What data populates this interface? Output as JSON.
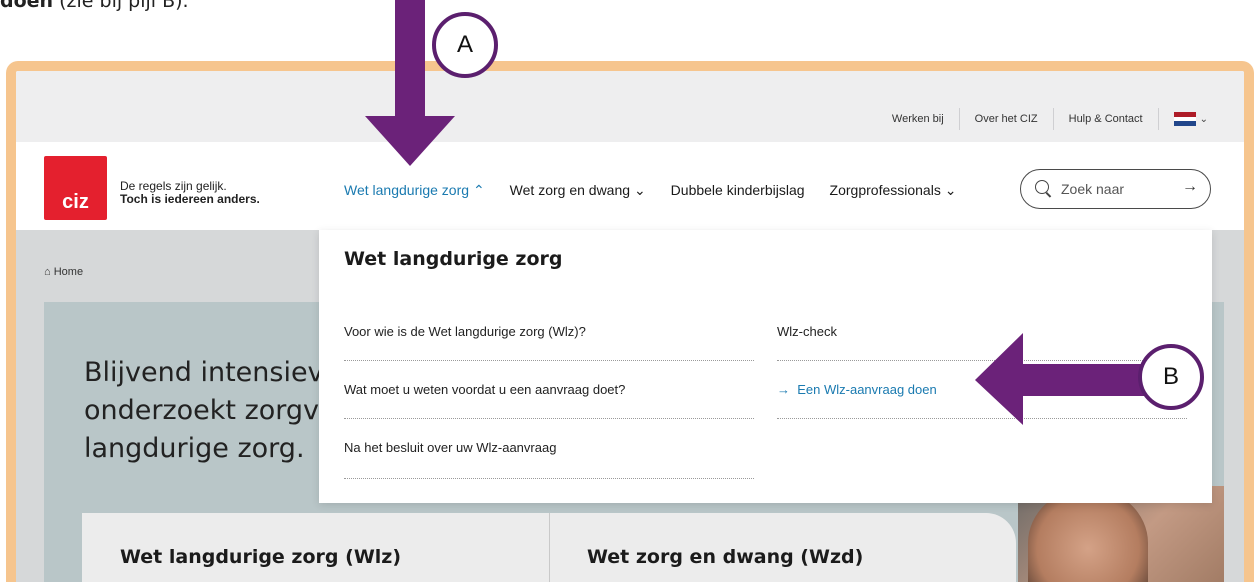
{
  "intro": {
    "bold": "doen",
    "rest": " (zie bij pijl B)."
  },
  "utility_nav": {
    "items": [
      "Werken bij",
      "Over het CIZ",
      "Hulp & Contact"
    ]
  },
  "language": {
    "flag_colors": [
      "#ae1c28",
      "#ffffff",
      "#21468b"
    ]
  },
  "logo": {
    "text": "ciz",
    "color": "#e4202e"
  },
  "tagline": {
    "line1": "De regels zijn gelijk.",
    "line2": "Toch is iedereen anders."
  },
  "main_nav": {
    "items": [
      {
        "label": "Wet langdurige zorg",
        "chevron": "⌃",
        "active": true
      },
      {
        "label": "Wet zorg en dwang",
        "chevron": "⌄"
      },
      {
        "label": "Dubbele kinderbijslag"
      },
      {
        "label": "Zorgprofessionals",
        "chevron": "⌄"
      }
    ]
  },
  "search": {
    "placeholder": "Zoek naar"
  },
  "breadcrumb": {
    "home": "Home"
  },
  "hero": {
    "line1": "Blijvend intensiev",
    "line2": "onderzoekt zorgv",
    "line3": "langdurige zorg."
  },
  "cards": {
    "left": "Wet langdurige zorg (Wlz)",
    "right": "Wet zorg en dwang (Wzd)"
  },
  "dropdown": {
    "title": "Wet langdurige zorg",
    "left_links": [
      "Voor wie is de Wet langdurige zorg (Wlz)?",
      "Wat moet u weten voordat u een aanvraag doet?",
      "Na het besluit over uw Wlz-aanvraag"
    ],
    "right_links": [
      "Wlz-check",
      "Een Wlz-aanvraag doen"
    ]
  },
  "annotations": {
    "a": "A",
    "b": "B",
    "arrow_color": "#6b2279",
    "frame_color": "#f6c58e"
  }
}
